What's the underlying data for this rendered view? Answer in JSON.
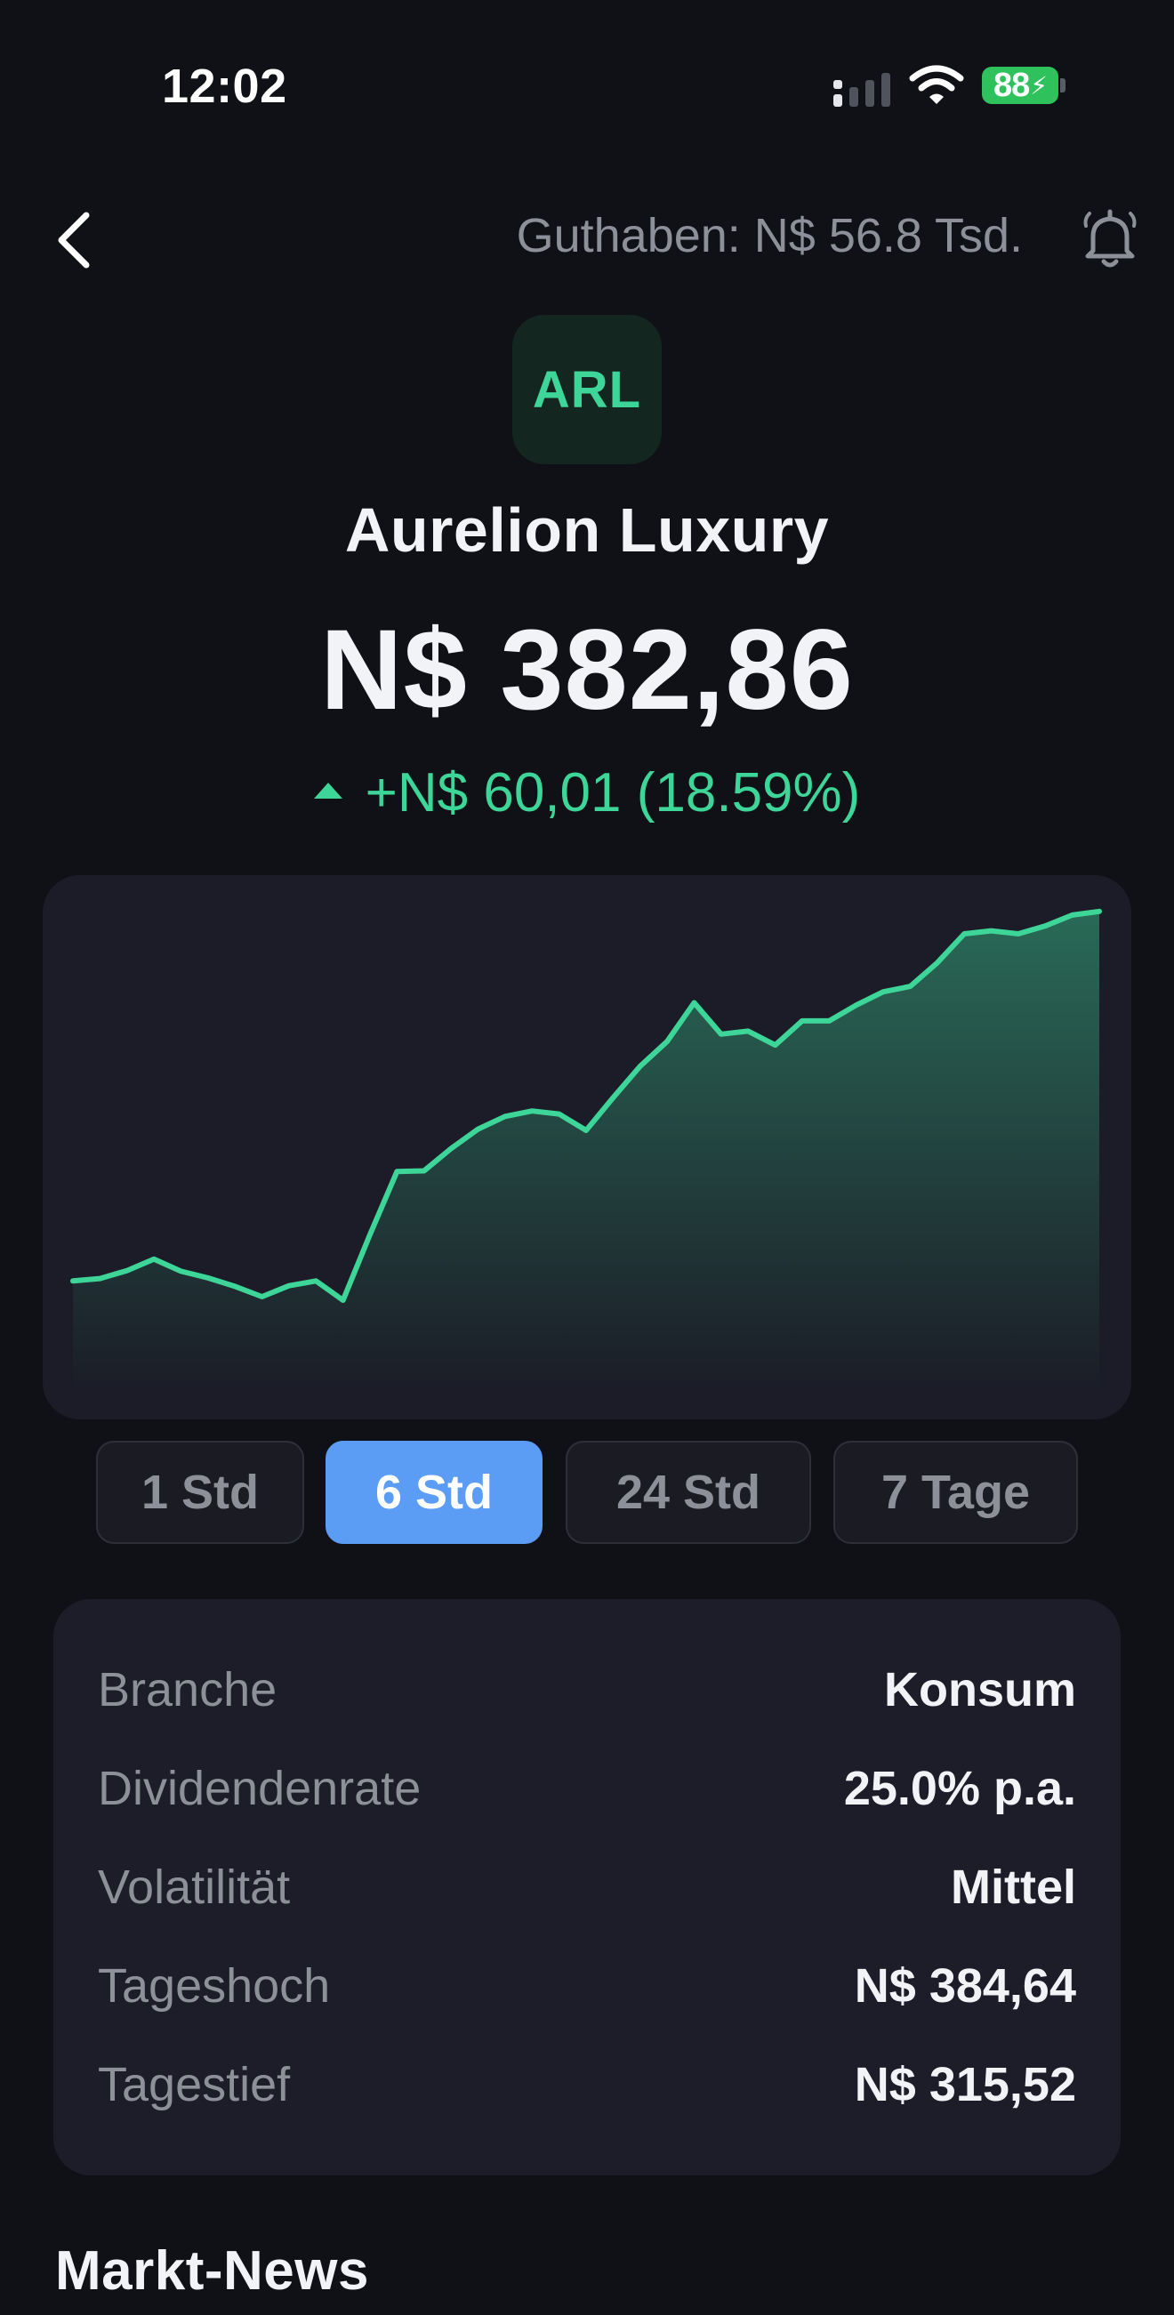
{
  "status_bar": {
    "time": "12:02",
    "battery": "88",
    "icons": [
      "signal-icon",
      "wifi-icon",
      "battery-charging-icon"
    ]
  },
  "header": {
    "balance": "Guthaben: N$ 56.8 Tsd.",
    "icons": [
      "back-chevron-icon",
      "bell-icon"
    ]
  },
  "stock": {
    "ticker": "ARL",
    "name": "Aurelion Luxury",
    "price": "N$ 382,86",
    "change": "+N$ 60,01 (18.59%)",
    "change_direction": "up"
  },
  "colors": {
    "background": "#101116",
    "card": "#1B1C27",
    "positive": "#3DD598",
    "accent": "#5B9CF4",
    "muted_text": "#8D8F99"
  },
  "chart_data": {
    "type": "area",
    "title": "",
    "xlabel": "",
    "ylabel": "",
    "grid": false,
    "legend": "none",
    "ylim": [
      300,
      390
    ],
    "series": [
      {
        "values": [
          322.9,
          323.3,
          324.6,
          326.5,
          324.5,
          323.4,
          322.0,
          320.3,
          322.1,
          322.9,
          319.7,
          330.6,
          341.0,
          341.1,
          344.8,
          348.0,
          350.1,
          351.0,
          350.5,
          347.8,
          353.2,
          358.4,
          362.5,
          368.9,
          363.7,
          364.2,
          361.9,
          365.9,
          365.9,
          368.5,
          370.7,
          371.6,
          375.5,
          380.3,
          380.8,
          380.3,
          381.6,
          383.4,
          384.0
        ]
      }
    ]
  },
  "range_tabs": [
    {
      "label": "1 Std",
      "active": false
    },
    {
      "label": "6 Std",
      "active": true
    },
    {
      "label": "24 Std",
      "active": false
    },
    {
      "label": "7 Tage",
      "active": false
    }
  ],
  "details": [
    {
      "label": "Branche",
      "value": "Konsum"
    },
    {
      "label": "Dividendenrate",
      "value": "25.0% p.a."
    },
    {
      "label": "Volatilität",
      "value": "Mittel"
    },
    {
      "label": "Tageshoch",
      "value": "N$ 384,64"
    },
    {
      "label": "Tagestief",
      "value": "N$ 315,52"
    }
  ],
  "news": {
    "title": "Markt-News"
  }
}
